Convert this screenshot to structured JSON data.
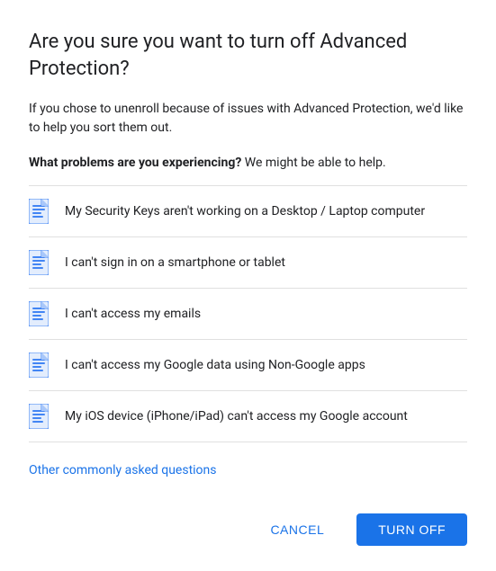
{
  "dialog": {
    "title": "Are you sure you want to turn off Advanced Protection?",
    "subtitle": "If you chose to unenroll because of issues with Advanced Protection, we'd like to help you sort them out.",
    "question_bold": "What problems are you experiencing?",
    "question_rest": " We might be able to help.",
    "items": [
      {
        "id": 1,
        "text": "My Security Keys aren't working on a Desktop / Laptop computer"
      },
      {
        "id": 2,
        "text": "I can't sign in on a smartphone or tablet"
      },
      {
        "id": 3,
        "text": "I can't access my emails"
      },
      {
        "id": 4,
        "text": "I can't access my Google data using Non-Google apps"
      },
      {
        "id": 5,
        "text": "My iOS device (iPhone/iPad) can't access my Google account"
      }
    ],
    "other_questions_link": "Other commonly asked questions",
    "cancel_label": "CANCEL",
    "turnoff_label": "TURN OFF"
  }
}
